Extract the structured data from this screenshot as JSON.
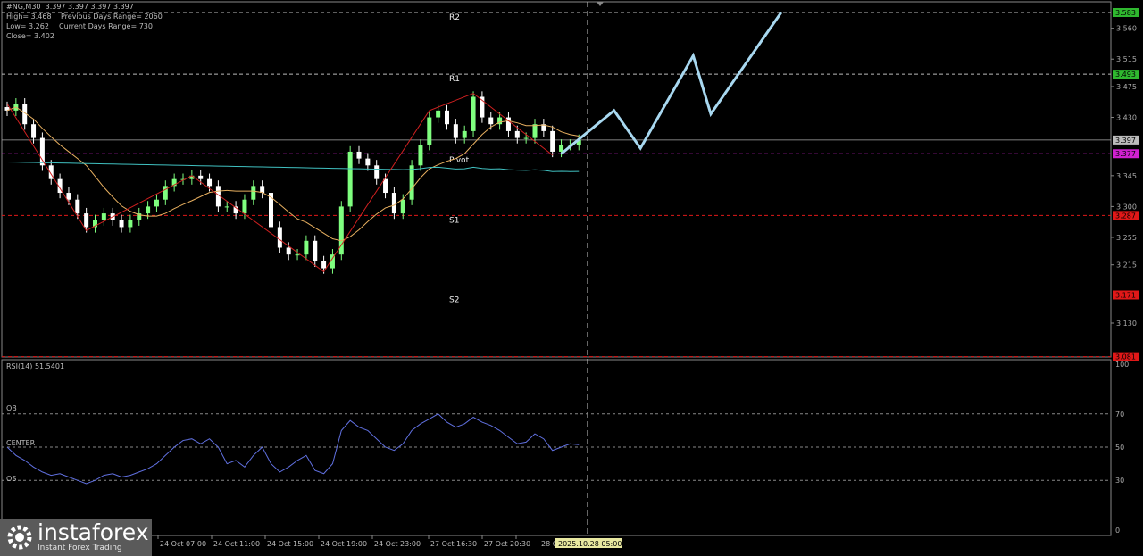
{
  "header": {
    "symbol_line": "#NG,M30  3.397 3.397 3.397 3.397",
    "high": "High= 3.468",
    "low": "Low= 3.262",
    "close": "Close= 3.402",
    "prev_range": "Previous Days Range= 2060",
    "curr_range": "Current Days Range= 730"
  },
  "levels": [
    {
      "name": "R2",
      "price": 3.583,
      "label": "3.583",
      "color": "#2fb82f"
    },
    {
      "name": "R1",
      "price": 3.493,
      "label": "3.493",
      "color": "#2fb82f"
    },
    {
      "name": "Pivot",
      "price": 3.377,
      "label": "3.377",
      "color": "#d020d0"
    },
    {
      "name": "S1",
      "price": 3.287,
      "label": "3.287",
      "color": "#e01818"
    },
    {
      "name": "S2",
      "price": 3.171,
      "label": "3.171",
      "color": "#e01818"
    },
    {
      "name": "",
      "price": 3.081,
      "label": "3.081",
      "color": "#e01818"
    }
  ],
  "current_price": {
    "price": 3.397,
    "label": "3.397"
  },
  "price_axis_ticks": [
    "3.560",
    "3.515",
    "3.475",
    "3.430",
    "3.345",
    "3.300",
    "3.255",
    "3.215",
    "3.130"
  ],
  "time_axis_ticks": [
    "24 Oct 07:00",
    "24 Oct 11:00",
    "24 Oct 15:00",
    "24 Oct 19:00",
    "24 Oct 23:00",
    "27 Oct 16:30",
    "27 Oct 20:30",
    "28 O"
  ],
  "time_cursor_label": "2025.10.28 05:00",
  "rsi": {
    "title": "RSI(14) 51.5401",
    "ob": "OB",
    "center": "CENTER",
    "os": "OS",
    "ticks": [
      "100",
      "70",
      "50",
      "30",
      "0"
    ]
  },
  "logo": {
    "brand": "instaforex",
    "tagline": "Instant Forex Trading"
  },
  "colors": {
    "bull": "#7fff7f",
    "bear": "#ffffff",
    "ma_fast": "#e8b060",
    "ma_slow": "#40c0c0",
    "zigzag": "#d02020",
    "forecast": "#a8d8f0",
    "rsi": "#6070e0"
  },
  "chart_data": {
    "type": "candlestick",
    "closes": [
      3.44,
      3.45,
      3.42,
      3.4,
      3.36,
      3.34,
      3.32,
      3.31,
      3.29,
      3.27,
      3.28,
      3.29,
      3.28,
      3.27,
      3.28,
      3.29,
      3.3,
      3.31,
      3.33,
      3.34,
      3.34,
      3.345,
      3.34,
      3.33,
      3.3,
      3.3,
      3.29,
      3.31,
      3.33,
      3.32,
      3.27,
      3.24,
      3.23,
      3.23,
      3.25,
      3.22,
      3.21,
      3.23,
      3.3,
      3.38,
      3.37,
      3.36,
      3.34,
      3.32,
      3.29,
      3.31,
      3.36,
      3.39,
      3.43,
      3.44,
      3.42,
      3.4,
      3.41,
      3.46,
      3.43,
      3.42,
      3.43,
      3.41,
      3.4,
      3.4,
      3.42,
      3.41,
      3.38,
      3.39,
      3.39,
      3.397
    ],
    "zigzag": [
      [
        0,
        3.45
      ],
      [
        9,
        3.265
      ],
      [
        21,
        3.345
      ],
      [
        36,
        3.205
      ],
      [
        48,
        3.44
      ],
      [
        53,
        3.465
      ],
      [
        62,
        3.375
      ]
    ],
    "forecast": [
      [
        63,
        3.377
      ],
      [
        69,
        3.44
      ],
      [
        72,
        3.385
      ],
      [
        78,
        3.52
      ],
      [
        80,
        3.435
      ],
      [
        88,
        3.583
      ]
    ],
    "rsi_values": [
      50,
      45,
      42,
      38,
      35,
      33,
      34,
      32,
      30,
      28,
      30,
      33,
      34,
      32,
      33,
      35,
      37,
      40,
      45,
      50,
      54,
      55,
      52,
      55,
      50,
      40,
      42,
      38,
      45,
      50,
      40,
      35,
      38,
      42,
      45,
      36,
      34,
      40,
      60,
      66,
      62,
      60,
      55,
      50,
      48,
      52,
      60,
      64,
      67,
      70,
      65,
      62,
      64,
      68,
      65,
      63,
      60,
      56,
      52,
      53,
      58,
      55,
      48,
      50,
      52,
      51.5
    ]
  }
}
